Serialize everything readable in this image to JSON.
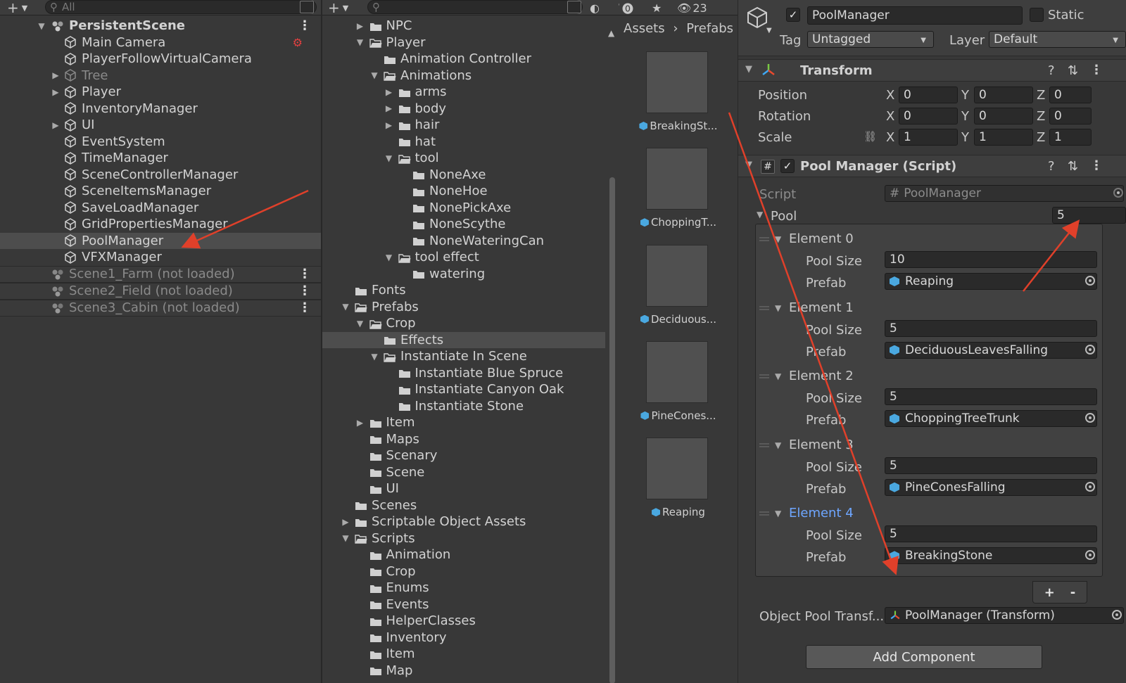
{
  "hierarchy": {
    "search_placeholder": "All",
    "scene_name": "PersistentScene",
    "items": [
      {
        "label": "Main Camera"
      },
      {
        "label": "PlayerFollowVirtualCamera"
      },
      {
        "label": "Tree"
      },
      {
        "label": "Player"
      },
      {
        "label": "InventoryManager"
      },
      {
        "label": "UI"
      },
      {
        "label": "EventSystem"
      },
      {
        "label": "TimeManager"
      },
      {
        "label": "SceneControllerManager"
      },
      {
        "label": "SceneItemsManager"
      },
      {
        "label": "SaveLoadManager"
      },
      {
        "label": "GridPropertiesManager"
      },
      {
        "label": "PoolManager"
      },
      {
        "label": "VFXManager"
      }
    ],
    "unloaded_scenes": [
      {
        "label": "Scene1_Farm (not loaded)"
      },
      {
        "label": "Scene2_Field (not loaded)"
      },
      {
        "label": "Scene3_Cabin (not loaded)"
      }
    ]
  },
  "project": {
    "hidden_count": "23",
    "folders": [
      {
        "label": "NPC"
      },
      {
        "label": "Player"
      },
      {
        "label": "Animation Controller"
      },
      {
        "label": "Animations"
      },
      {
        "label": "arms"
      },
      {
        "label": "body"
      },
      {
        "label": "hair"
      },
      {
        "label": "hat"
      },
      {
        "label": "tool"
      },
      {
        "label": "NoneAxe"
      },
      {
        "label": "NoneHoe"
      },
      {
        "label": "NonePickAxe"
      },
      {
        "label": "NoneScythe"
      },
      {
        "label": "NoneWateringCan"
      },
      {
        "label": "tool effect"
      },
      {
        "label": "watering"
      },
      {
        "label": "Fonts"
      },
      {
        "label": "Prefabs"
      },
      {
        "label": "Crop"
      },
      {
        "label": "Effects"
      },
      {
        "label": "Instantiate In Scene"
      },
      {
        "label": "Instantiate Blue Spruce"
      },
      {
        "label": "Instantiate Canyon Oak"
      },
      {
        "label": "Instantiate Stone"
      },
      {
        "label": "Item"
      },
      {
        "label": "Maps"
      },
      {
        "label": "Scenary"
      },
      {
        "label": "Scene"
      },
      {
        "label": "UI"
      },
      {
        "label": "Scenes"
      },
      {
        "label": "Scriptable Object Assets"
      },
      {
        "label": "Scripts"
      },
      {
        "label": "Animation"
      },
      {
        "label": "Crop"
      },
      {
        "label": "Enums"
      },
      {
        "label": "Events"
      },
      {
        "label": "HelperClasses"
      },
      {
        "label": "Inventory"
      },
      {
        "label": "Item"
      },
      {
        "label": "Map"
      }
    ]
  },
  "assets": {
    "breadcrumb": [
      "Assets",
      "Prefabs"
    ],
    "items": [
      {
        "label": "BreakingSt..."
      },
      {
        "label": "ChoppingT..."
      },
      {
        "label": "Deciduous..."
      },
      {
        "label": "PineCones..."
      },
      {
        "label": "Reaping"
      }
    ]
  },
  "inspector": {
    "object_name": "PoolManager",
    "static_label": "Static",
    "tag_label": "Tag",
    "tag_value": "Untagged",
    "layer_label": "Layer",
    "layer_value": "Default",
    "transform": {
      "title": "Transform",
      "position_label": "Position",
      "rotation_label": "Rotation",
      "scale_label": "Scale",
      "x": "X",
      "y": "Y",
      "z": "Z",
      "position": [
        "0",
        "0",
        "0"
      ],
      "rotation": [
        "0",
        "0",
        "0"
      ],
      "scale": [
        "1",
        "1",
        "1"
      ]
    },
    "script_component": {
      "title": "Pool Manager (Script)",
      "script_label": "Script",
      "script_value": "PoolManager",
      "pool_label": "Pool",
      "pool_size": "5",
      "pool_size_label": "Pool Size",
      "prefab_label": "Prefab",
      "elements": [
        {
          "label": "Element 0",
          "pool_size": "10",
          "prefab": "Reaping"
        },
        {
          "label": "Element 1",
          "pool_size": "5",
          "prefab": "DeciduousLeavesFalling"
        },
        {
          "label": "Element 2",
          "pool_size": "5",
          "prefab": "ChoppingTreeTrunk"
        },
        {
          "label": "Element 3",
          "pool_size": "5",
          "prefab": "PineConesFalling"
        },
        {
          "label": "Element 4",
          "pool_size": "5",
          "prefab": "BreakingStone"
        }
      ],
      "add_label": "+",
      "remove_label": "-",
      "object_pool_label": "Object Pool Transf...",
      "object_pool_value": "PoolManager (Transform)"
    },
    "add_component": "Add Component"
  },
  "colors": {
    "annotation": "#e0402a",
    "selected_element": "#6ea6ff",
    "prefab_icon": "#4aa8e0"
  }
}
